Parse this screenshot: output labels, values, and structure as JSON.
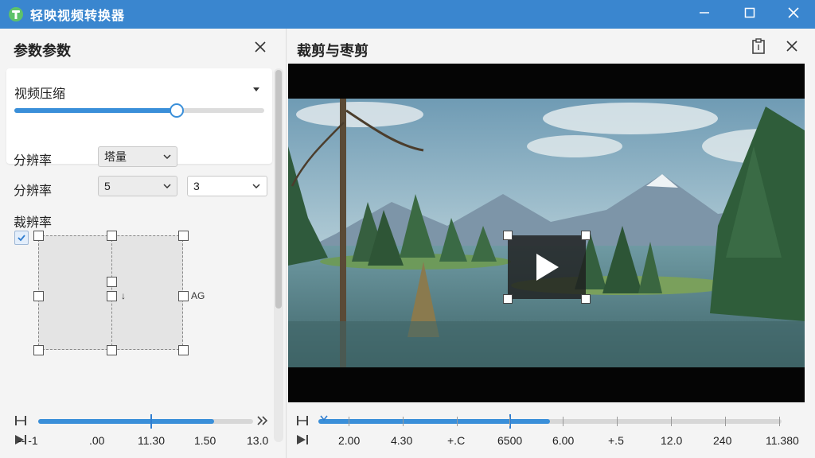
{
  "app": {
    "title": "轻映视频转换器",
    "brand_color": "#3a86cf",
    "accent_color": "#3a8fd9"
  },
  "window_controls": [
    "minimize-icon",
    "maximize-icon",
    "close-icon"
  ],
  "left_panel": {
    "title": "参数参数",
    "compression": {
      "label": "视频压缩",
      "slider_fraction": 0.65
    },
    "rows": [
      {
        "label": "分辨率",
        "select": "塔量"
      },
      {
        "label": "分辨率",
        "select_a": "5",
        "select_b": "3"
      }
    ],
    "crop_label": "裁辨率",
    "crop_checked": true,
    "crop_text_1": "↓",
    "crop_text_2": "AG",
    "timeline": {
      "fill_fraction": 0.82,
      "labels": [
        "-- -1",
        ".00",
        "11.30",
        "1.50",
        "13.0"
      ]
    }
  },
  "right_panel": {
    "title": "裁剪与枣剪",
    "icons": [
      "clipboard-icon",
      "close-icon"
    ],
    "timeline": {
      "fill_fraction": 0.5,
      "labels": [
        "2.00",
        "4.30",
        "+.C",
        "6500",
        "6.00",
        "+.5",
        "12.0",
        "240",
        "11.380"
      ]
    }
  }
}
